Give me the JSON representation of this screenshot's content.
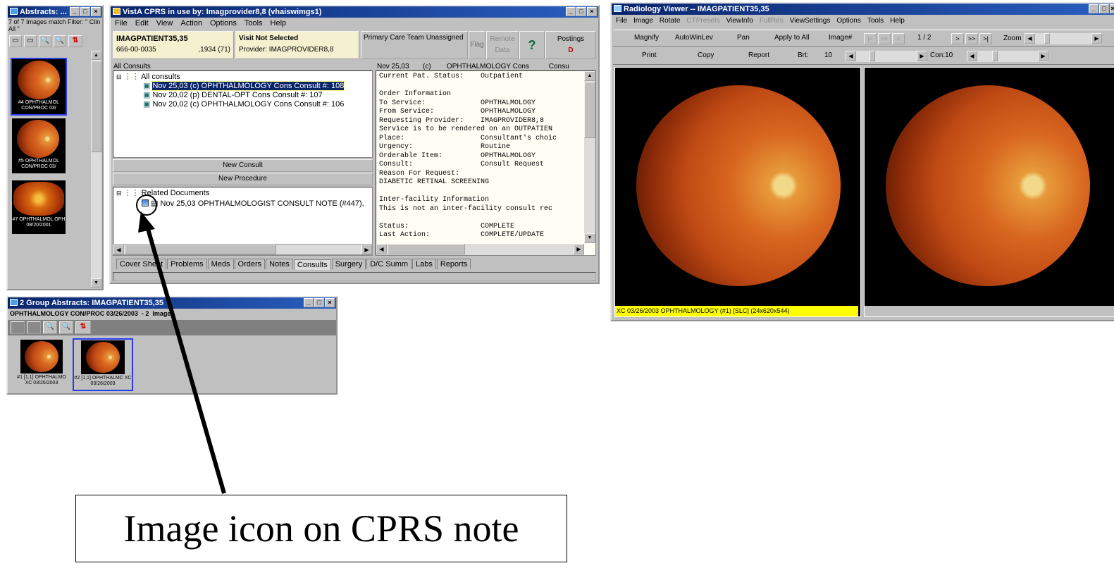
{
  "abstracts": {
    "title": "Abstracts: ...",
    "filter": "7 of 7 Images match Filter: \" Clin All \"",
    "items": [
      {
        "label": "#4 OPHTHALMOL CON/PROC 03/"
      },
      {
        "label": "#5 OPHTHALMOL CON/PROC 03/"
      },
      {
        "label": "#7 OPHTHALMOL OPH 08/20/2001"
      }
    ]
  },
  "cprs": {
    "title": "VistA CPRS in use by: Imagprovider8,8  (vhaiswimgs1)",
    "menu": [
      "File",
      "Edit",
      "View",
      "Action",
      "Options",
      "Tools",
      "Help"
    ],
    "patient_name": "IMAGPATIENT35,35",
    "patient_id": "666-00-0035",
    "patient_dob": ",1934 (71)",
    "visit": "Visit Not Selected",
    "provider": "Provider:  IMAGPROVIDER8,8",
    "team": "Primary Care Team Unassigned",
    "flag": "Flag",
    "remote": "Remote Data",
    "help": "?",
    "postings": "Postings",
    "postings_sub": "D",
    "consults_label": "All Consults",
    "tree_root": "All consults",
    "consults": [
      "Nov 25,03  (c)  OPHTHALMOLOGY Cons Consult #: 108",
      "Nov 20,02  (p)  DENTAL-OPT Cons Consult #: 107",
      "Nov 20,02  (c)  OPHTHALMOLOGY Cons Consult #: 106"
    ],
    "new_consult": "New Consult",
    "new_procedure": "New Procedure",
    "related_root": "Related Documents",
    "related_doc": "Nov 25,03  OPHTHALMOLOGIST CONSULT NOTE (#447),",
    "detail_header": "Nov 25,03       (c)        OPHTHALMOLOGY Cons          Consu",
    "detail_lines": [
      "Current Pat. Status:    Outpatient",
      "",
      "Order Information",
      "To Service:             OPHTHALMOLOGY",
      "From Service:           OPHTHALMOLOGY",
      "Requesting Provider:    IMAGPROVIDER8,8",
      "Service is to be rendered on an OUTPATIEN",
      "Place:                  Consultant's choic",
      "Urgency:                Routine",
      "Orderable Item:         OPHTHALMOLOGY",
      "Consult:                Consult Request",
      "Reason For Request:",
      "DIABETIC RETINAL SCREENING",
      "",
      "Inter-facility Information",
      "This is not an inter-facility consult rec",
      "",
      "Status:                 COMPLETE",
      "Last Action:            COMPLETE/UPDATE"
    ],
    "tabs": [
      "Cover Sheet",
      "Problems",
      "Meds",
      "Orders",
      "Notes",
      "Consults",
      "Surgery",
      "D/C Summ",
      "Labs",
      "Reports"
    ]
  },
  "group": {
    "title": "2 Group Abstracts: IMAGPATIENT35,35",
    "subtitle": "OPHTHALMOLOGY CON/PROC 03/26/2003  - 2  Images",
    "items": [
      {
        "label": "#1 [1,1] OPHTHALMO XC 03/26/2003"
      },
      {
        "label": "#2 [1,1] OPHTHALMC XC 03/26/2003"
      }
    ]
  },
  "viewer": {
    "title": "Radiology Viewer -- IMAGPATIENT35,35",
    "menu": [
      "File",
      "Image",
      "Rotate",
      "CTPresets",
      "ViewInfo",
      "FullRes",
      "ViewSettings",
      "Options",
      "Tools",
      "Help"
    ],
    "magnify": "Magnify",
    "autowinlev": "AutoWinLev",
    "pan": "Pan",
    "apply_all": "Apply to All",
    "image_num": "Image#",
    "page": "1 / 2",
    "zoom": "Zoom",
    "print": "Print",
    "copy": "Copy",
    "report": "Report",
    "brt": "Brt:",
    "brt_val": "10",
    "con": "Con:10",
    "status": "XC 03/26/2003 OPHTHALMOLOGY (#1) [SLC]  (24x620x544)"
  },
  "callout": {
    "text": "Image icon on CPRS note"
  }
}
